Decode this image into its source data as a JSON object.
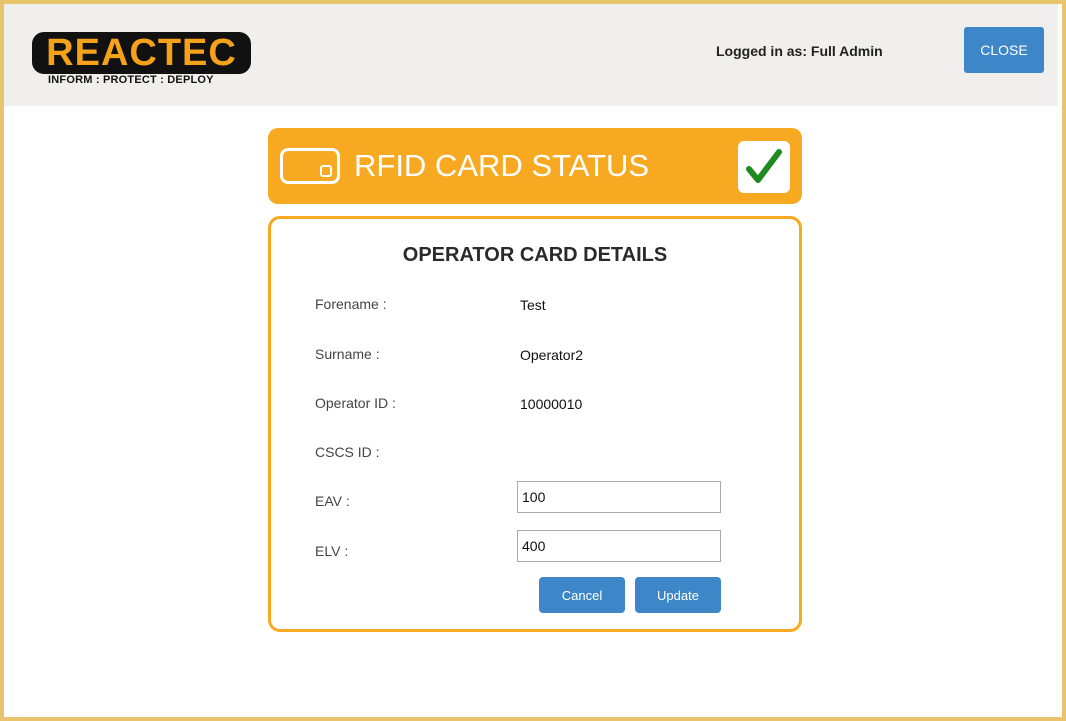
{
  "header": {
    "logo_word": "REACTEC",
    "logo_tagline": "INFORM : PROTECT : DEPLOY",
    "login_text": "Logged in as: Full Admin",
    "close_label": "CLOSE"
  },
  "status": {
    "title": "RFID CARD STATUS",
    "icon": "rfid-card-icon",
    "state_icon": "checkmark-icon"
  },
  "details": {
    "title": "OPERATOR CARD DETAILS",
    "forename_label": "Forename :",
    "forename_value": "Test",
    "surname_label": "Surname :",
    "surname_value": "Operator2",
    "operator_id_label": "Operator ID :",
    "operator_id_value": "10000010",
    "cscs_id_label": "CSCS ID :",
    "cscs_id_value": "",
    "eav_label": "EAV :",
    "eav_value": "100",
    "elv_label": "ELV :",
    "elv_value": "400",
    "cancel_label": "Cancel",
    "update_label": "Update"
  },
  "colors": {
    "accent_orange": "#f8a922",
    "button_blue": "#3d87c9",
    "frame_gold": "#e8c46c",
    "check_green": "#1f8a1f"
  }
}
